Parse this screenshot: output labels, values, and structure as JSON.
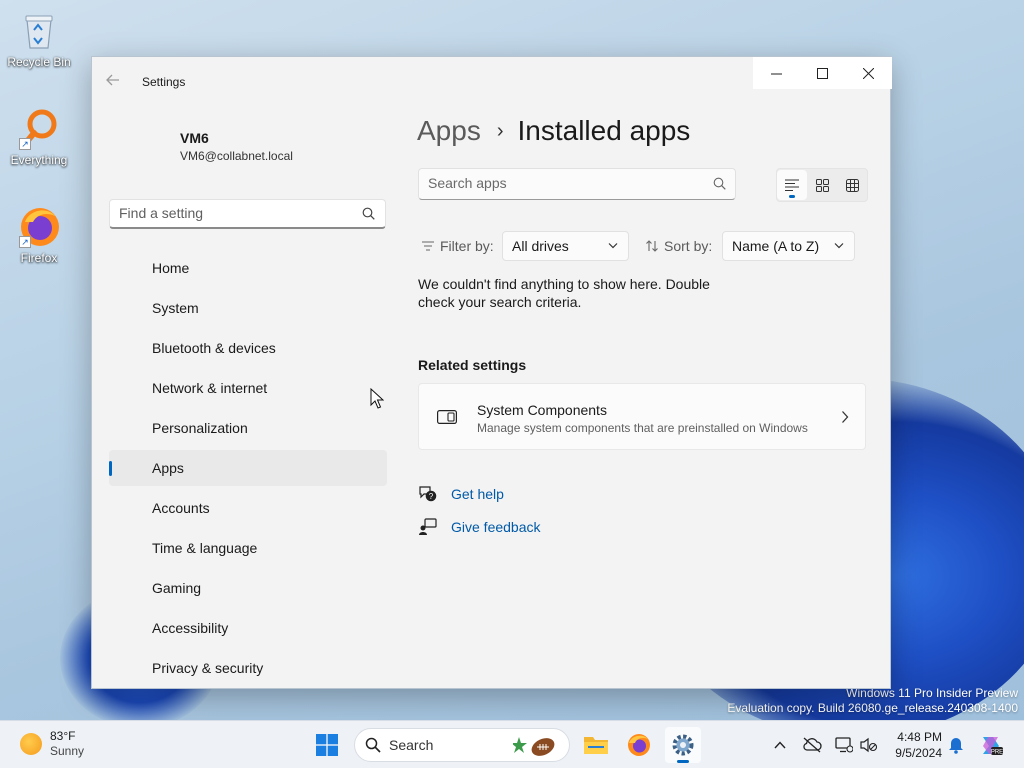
{
  "desktop": {
    "icons": [
      {
        "label": "Recycle Bin"
      },
      {
        "label": "Everything"
      },
      {
        "label": "Firefox"
      }
    ],
    "watermark": {
      "line1": "Windows 11 Pro Insider Preview",
      "line2": "Evaluation copy. Build 26080.ge_release.240308-1400"
    }
  },
  "window": {
    "title": "Settings",
    "user": {
      "name": "VM6",
      "email": "VM6@collabnet.local"
    },
    "find_placeholder": "Find a setting",
    "nav": [
      {
        "label": "Home"
      },
      {
        "label": "System"
      },
      {
        "label": "Bluetooth & devices"
      },
      {
        "label": "Network & internet"
      },
      {
        "label": "Personalization"
      },
      {
        "label": "Apps",
        "active": true
      },
      {
        "label": "Accounts"
      },
      {
        "label": "Time & language"
      },
      {
        "label": "Gaming"
      },
      {
        "label": "Accessibility"
      },
      {
        "label": "Privacy & security"
      }
    ],
    "breadcrumb": {
      "parent": "Apps",
      "separator": "›",
      "current": "Installed apps"
    },
    "search_placeholder": "Search apps",
    "filter": {
      "label": "Filter by:",
      "value": "All drives"
    },
    "sort": {
      "label": "Sort by:",
      "value": "Name (A to Z)"
    },
    "empty_message": "We couldn't find anything to show here. Double check your search criteria.",
    "related": {
      "title": "Related settings",
      "card_title": "System Components",
      "card_subtitle": "Manage system components that are preinstalled on Windows"
    },
    "links": {
      "help": "Get help",
      "feedback": "Give feedback"
    },
    "accent_color": "#0067c0"
  },
  "taskbar": {
    "weather": {
      "temp": "83°F",
      "condition": "Sunny"
    },
    "search_label": "Search",
    "clock": {
      "time": "4:48 PM",
      "date": "9/5/2024"
    }
  }
}
